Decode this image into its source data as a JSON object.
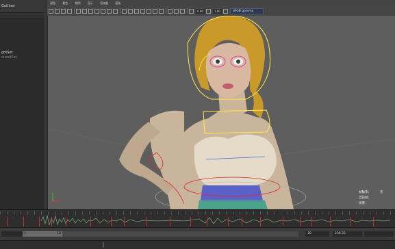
{
  "outliner": {
    "header_label": "Outliner",
    "items": [
      {
        "label": "ghtSet",
        "state": "active"
      },
      {
        "label": "ouredSet",
        "state": "dim"
      }
    ]
  },
  "menubar": {
    "items": [
      "视图",
      "着色",
      "照明",
      "显示",
      "渲染器",
      "面板"
    ]
  },
  "toolbar": {
    "field_a": "0.00",
    "field_b": "1.00",
    "camera_label": "sRGB gamma"
  },
  "hud": {
    "labels": [
      "帧数率：",
      "当前帧：",
      "场景："
    ],
    "values": [
      "",
      "",
      "无"
    ]
  },
  "timeslider": {
    "key_frames": [
      10,
      34,
      57,
      75,
      96,
      132,
      162,
      181,
      213,
      248,
      278,
      302,
      333,
      353,
      380,
      413,
      438,
      455,
      482,
      512,
      545
    ]
  },
  "rangebar": {
    "start_value": "1",
    "slider_end_value": "10",
    "range_end_value": "30",
    "fps_value": "238.33"
  },
  "colors": {
    "viewport_bg": "#5e5e5e",
    "key_mark": "#c03030",
    "rig_yellow": "#ffe94a",
    "rig_red": "#e02a2a",
    "skirt_blue": "#5a61c9"
  }
}
